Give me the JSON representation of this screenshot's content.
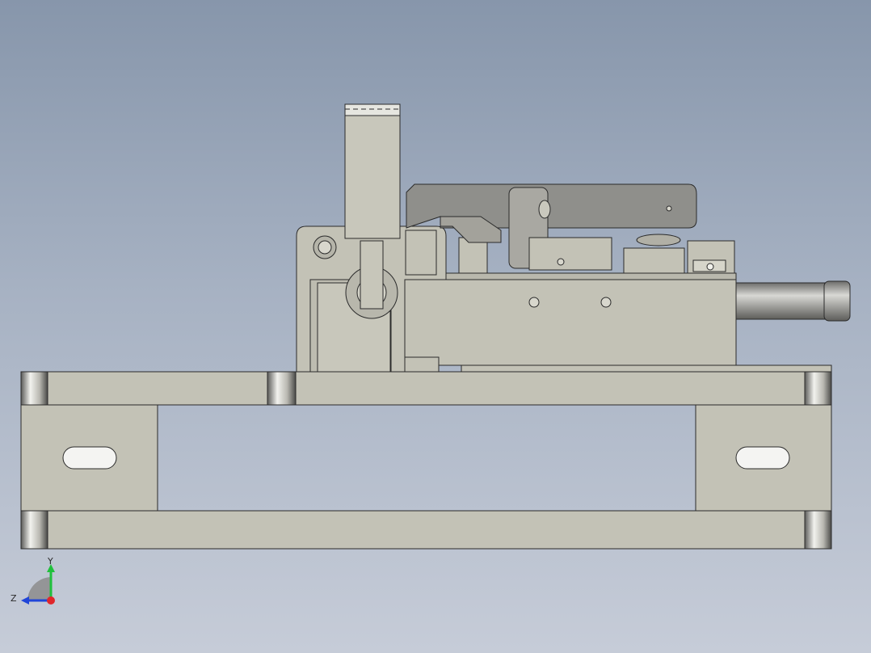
{
  "viewport": {
    "background_top": "#8796ab",
    "background_bottom": "#c6ccd8",
    "part_color": "#c3c2b6",
    "dark_part_color": "#8f8f8b",
    "edge_color": "#2b2b2b"
  },
  "triad": {
    "x_axis_color": "#e0262b",
    "y_axis_color": "#20c03c",
    "z_axis_color": "#2045d8",
    "y_label": "Y",
    "z_label": "Z"
  }
}
